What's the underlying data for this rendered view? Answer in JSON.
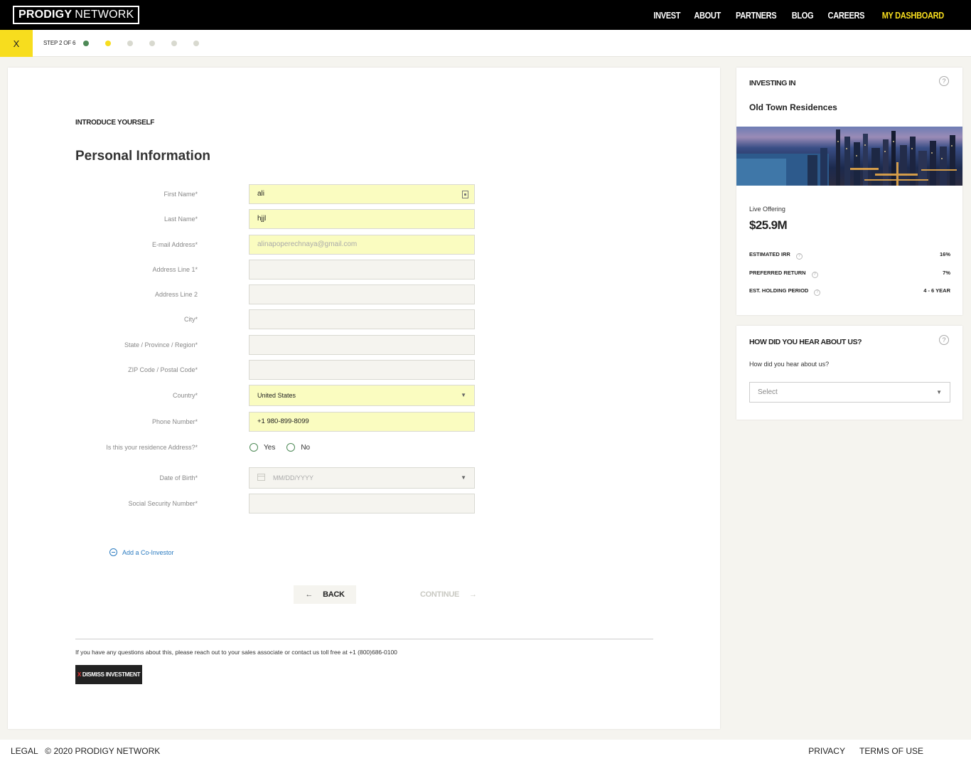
{
  "header": {
    "logo_bold": "PRODIGY",
    "logo_light": "NETWORK",
    "nav": [
      "INVEST",
      "ABOUT",
      "PARTNERS",
      "BLOG",
      "CAREERS",
      "MY DASHBOARD"
    ]
  },
  "stepbar": {
    "close_label": "X",
    "step_text": "STEP 2 OF 6"
  },
  "form": {
    "eyebrow": "INTRODUCE YOURSELF",
    "title": "Personal Information",
    "fields": {
      "first_name": {
        "label": "First Name*",
        "value": "ali"
      },
      "last_name": {
        "label": "Last Name*",
        "value": "hjjl"
      },
      "email": {
        "label": "E-mail Address*",
        "value": "alinapoperechnaya@gmail.com"
      },
      "address1": {
        "label": "Address Line 1*",
        "value": ""
      },
      "address2": {
        "label": "Address Line 2",
        "value": ""
      },
      "city": {
        "label": "City*",
        "value": ""
      },
      "state": {
        "label": "State / Province / Region*",
        "value": ""
      },
      "zip": {
        "label": "ZIP Code / Postal Code*",
        "value": ""
      },
      "country": {
        "label": "Country*",
        "value": "United States"
      },
      "phone": {
        "label": "Phone Number*",
        "value": "+1 980-899-8099"
      },
      "residence": {
        "label": "Is this your residence Address?*",
        "yes": "Yes",
        "no": "No"
      },
      "dob": {
        "label": "Date of Birth*",
        "placeholder": "MM/DD/YYYY"
      },
      "ssn": {
        "label": "Social Security Number*",
        "value": ""
      }
    },
    "add_coinvestor": "Add a Co-Investor",
    "back": "BACK",
    "continue": "CONTINUE",
    "help_text": "If you have any questions about this, please reach out to your sales associate or contact us toll free at +1 (800)686-0100",
    "dismiss_x": "X",
    "dismiss": "DISMISS INVESTMENT"
  },
  "investing": {
    "heading": "INVESTING IN",
    "property": "Old Town Residences",
    "live_label": "Live Offering",
    "amount": "$25.9M",
    "rows": [
      {
        "key": "ESTIMATED IRR",
        "value": "16%"
      },
      {
        "key": "PREFERRED RETURN",
        "value": "7%"
      },
      {
        "key": "EST. HOLDING PERIOD",
        "value": "4 - 6 YEAR"
      }
    ]
  },
  "hear": {
    "heading": "HOW DID YOU HEAR ABOUT US?",
    "question": "How did you hear about us?",
    "select": "Select"
  },
  "footer": {
    "legal": "LEGAL",
    "copyright": "© 2020 PRODIGY NETWORK",
    "privacy": "PRIVACY",
    "terms": "TERMS OF USE"
  },
  "colors": {
    "accent": "#f7dd1e",
    "done": "#4e8a57",
    "link": "#2b7bc0"
  },
  "icons": [
    "question-icon",
    "calendar-icon",
    "caret-down-icon",
    "arrow-left-icon",
    "arrow-right-icon",
    "plus-circle-icon",
    "contact-card-icon"
  ]
}
